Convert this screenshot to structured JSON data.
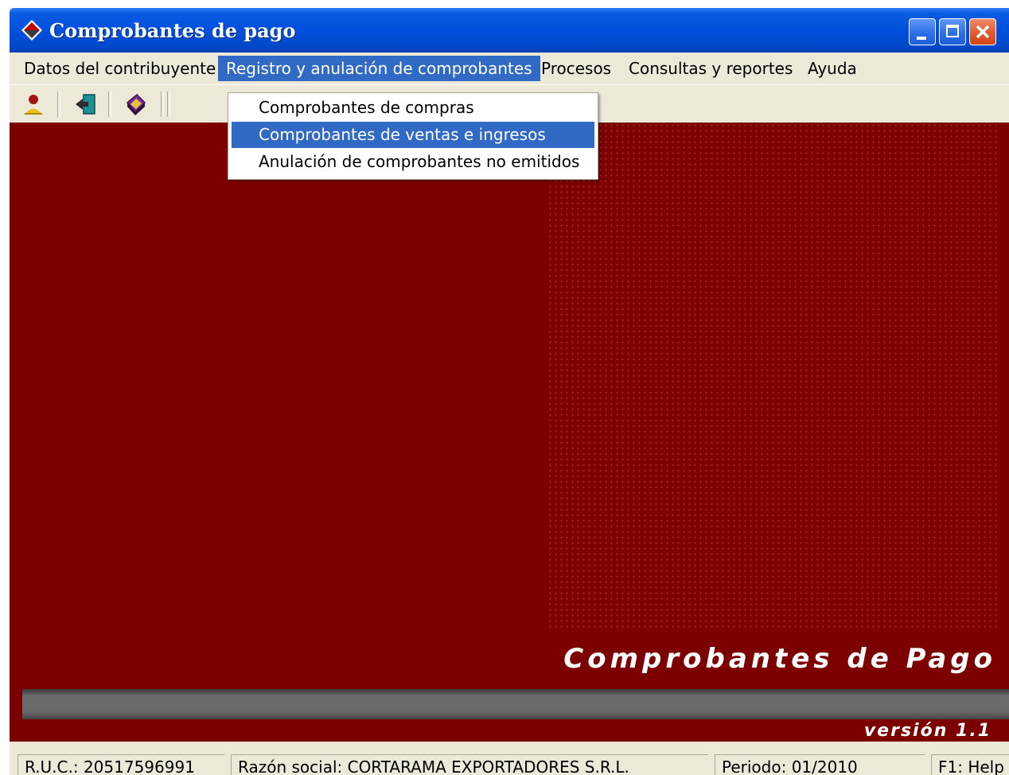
{
  "window": {
    "title": "Comprobantes de pago",
    "controls": [
      "minimize",
      "maximize",
      "close"
    ]
  },
  "menubar": {
    "items": [
      {
        "label": "Datos del contribuyente"
      },
      {
        "label": "Registro y anulación de comprobantes",
        "active": true
      },
      {
        "label": "Procesos"
      },
      {
        "label": "Consultas y reportes"
      },
      {
        "label": "Ayuda"
      }
    ]
  },
  "dropdown": {
    "items": [
      {
        "label": "Comprobantes de compras"
      },
      {
        "label": "Comprobantes de ventas e ingresos",
        "highlighted": true
      },
      {
        "label": "Anulación de comprobantes no emitidos"
      }
    ]
  },
  "toolbar": {
    "icons": [
      "user-icon",
      "exit-door-icon",
      "book-icon"
    ]
  },
  "main": {
    "brand": "Comprobantes de Pago",
    "version": "versión 1.1"
  },
  "statusbar": {
    "ruc": "R.U.C.: 20517596991",
    "razon_social": "Razón social: CORTARAMA EXPORTADORES S.R.L.",
    "periodo": "Periodo: 01/2010",
    "help": "F1: Help"
  },
  "colors": {
    "titlebar": "#0050de",
    "menu_highlight": "#316ac5",
    "background": "#7c0000",
    "chrome": "#ece9d8"
  }
}
